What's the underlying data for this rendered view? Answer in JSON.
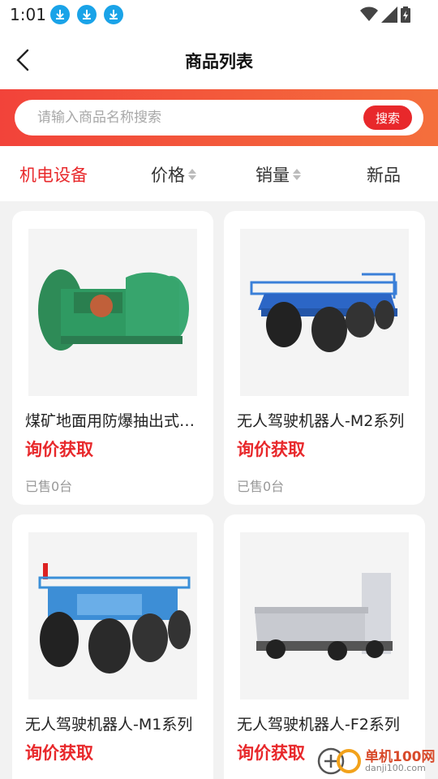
{
  "status_bar": {
    "time": "1:01",
    "icons": [
      "download-icon",
      "download-icon",
      "download-icon",
      "wifi-icon",
      "signal-icon",
      "battery-icon"
    ]
  },
  "header": {
    "title": "商品列表",
    "back_icon": "chevron-left-icon"
  },
  "search": {
    "placeholder": "请输入商品名称搜索",
    "value": "",
    "button_label": "搜索"
  },
  "filters": [
    {
      "label": "机电设备",
      "active": true,
      "sortable": false
    },
    {
      "label": "价格",
      "active": false,
      "sortable": true
    },
    {
      "label": "销量",
      "active": false,
      "sortable": true
    },
    {
      "label": "新品",
      "active": false,
      "sortable": false
    }
  ],
  "products": [
    {
      "name": "煤矿地面用防爆抽出式对旋轴流通风机",
      "price": "询价获取",
      "sold": "已售0台"
    },
    {
      "name": "无人驾驶机器人-M2系列",
      "price": "询价获取",
      "sold": "已售0台"
    },
    {
      "name": "无人驾驶机器人-M1系列",
      "price": "询价获取",
      "sold": ""
    },
    {
      "name": "无人驾驶机器人-F2系列",
      "price": "询价获取",
      "sold": ""
    }
  ],
  "watermark": {
    "title": "单机100网",
    "subtitle": "danji100.com"
  },
  "colors": {
    "accent": "#e8282b",
    "band_start": "#f2433a",
    "band_end": "#f46f3c",
    "download_icon": "#1aa3e8"
  }
}
